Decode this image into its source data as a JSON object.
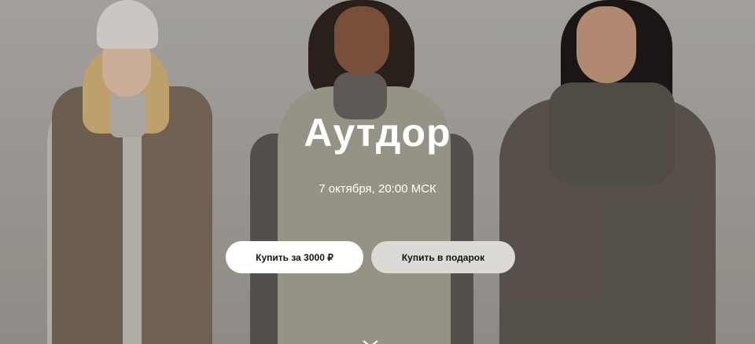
{
  "hero": {
    "title": "Аутдор",
    "date": "7 октября, 20:00 МСК",
    "buy_button": "Купить за 3000 ₽",
    "gift_button": "Купить в подарок",
    "scroll_icon": "chevron-down-icon"
  },
  "colors": {
    "background": "#b1ada8",
    "buy_button_bg": "#ffffff",
    "gift_button_bg": "#dcdad7",
    "text": "#ffffff"
  }
}
